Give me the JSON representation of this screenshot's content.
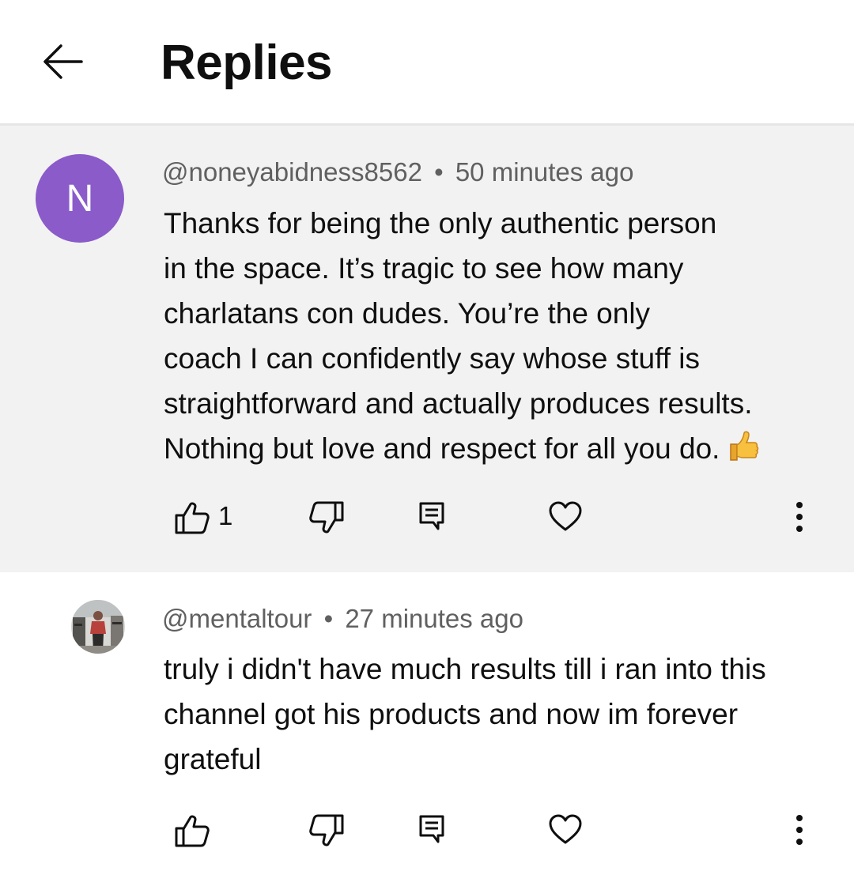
{
  "header": {
    "title": "Replies",
    "back_icon": "arrow-left-icon"
  },
  "comments": [
    {
      "avatar_letter": "N",
      "avatar_color": "#8a5bc9",
      "handle": "@noneyabidness8562",
      "separator": "•",
      "time": "50 minutes ago",
      "lines": [
        "Thanks for being the only authentic person",
        "in the space. It’s tragic to see how many",
        "charlatans con dudes. You’re the only",
        "coach I can confidently say whose stuff is",
        "straightforward and actually produces results.",
        "Nothing but love and respect for all you do."
      ],
      "emoji_icon": "thumbs-up-emoji-icon",
      "like_count": "1",
      "background": "#f2f2f2"
    },
    {
      "avatar_icon": "user-photo-avatar",
      "handle": "@mentaltour",
      "separator": "•",
      "time": "27 minutes ago",
      "lines": [
        "truly i didn't have much results till i ran into this",
        "channel got his products and now im forever",
        "grateful"
      ],
      "like_count": "",
      "background": "#ffffff"
    }
  ],
  "icons": {
    "like": "thumbs-up-icon",
    "dislike": "thumbs-down-icon",
    "reply": "comment-icon",
    "heart": "heart-icon",
    "more": "more-vertical-icon"
  }
}
